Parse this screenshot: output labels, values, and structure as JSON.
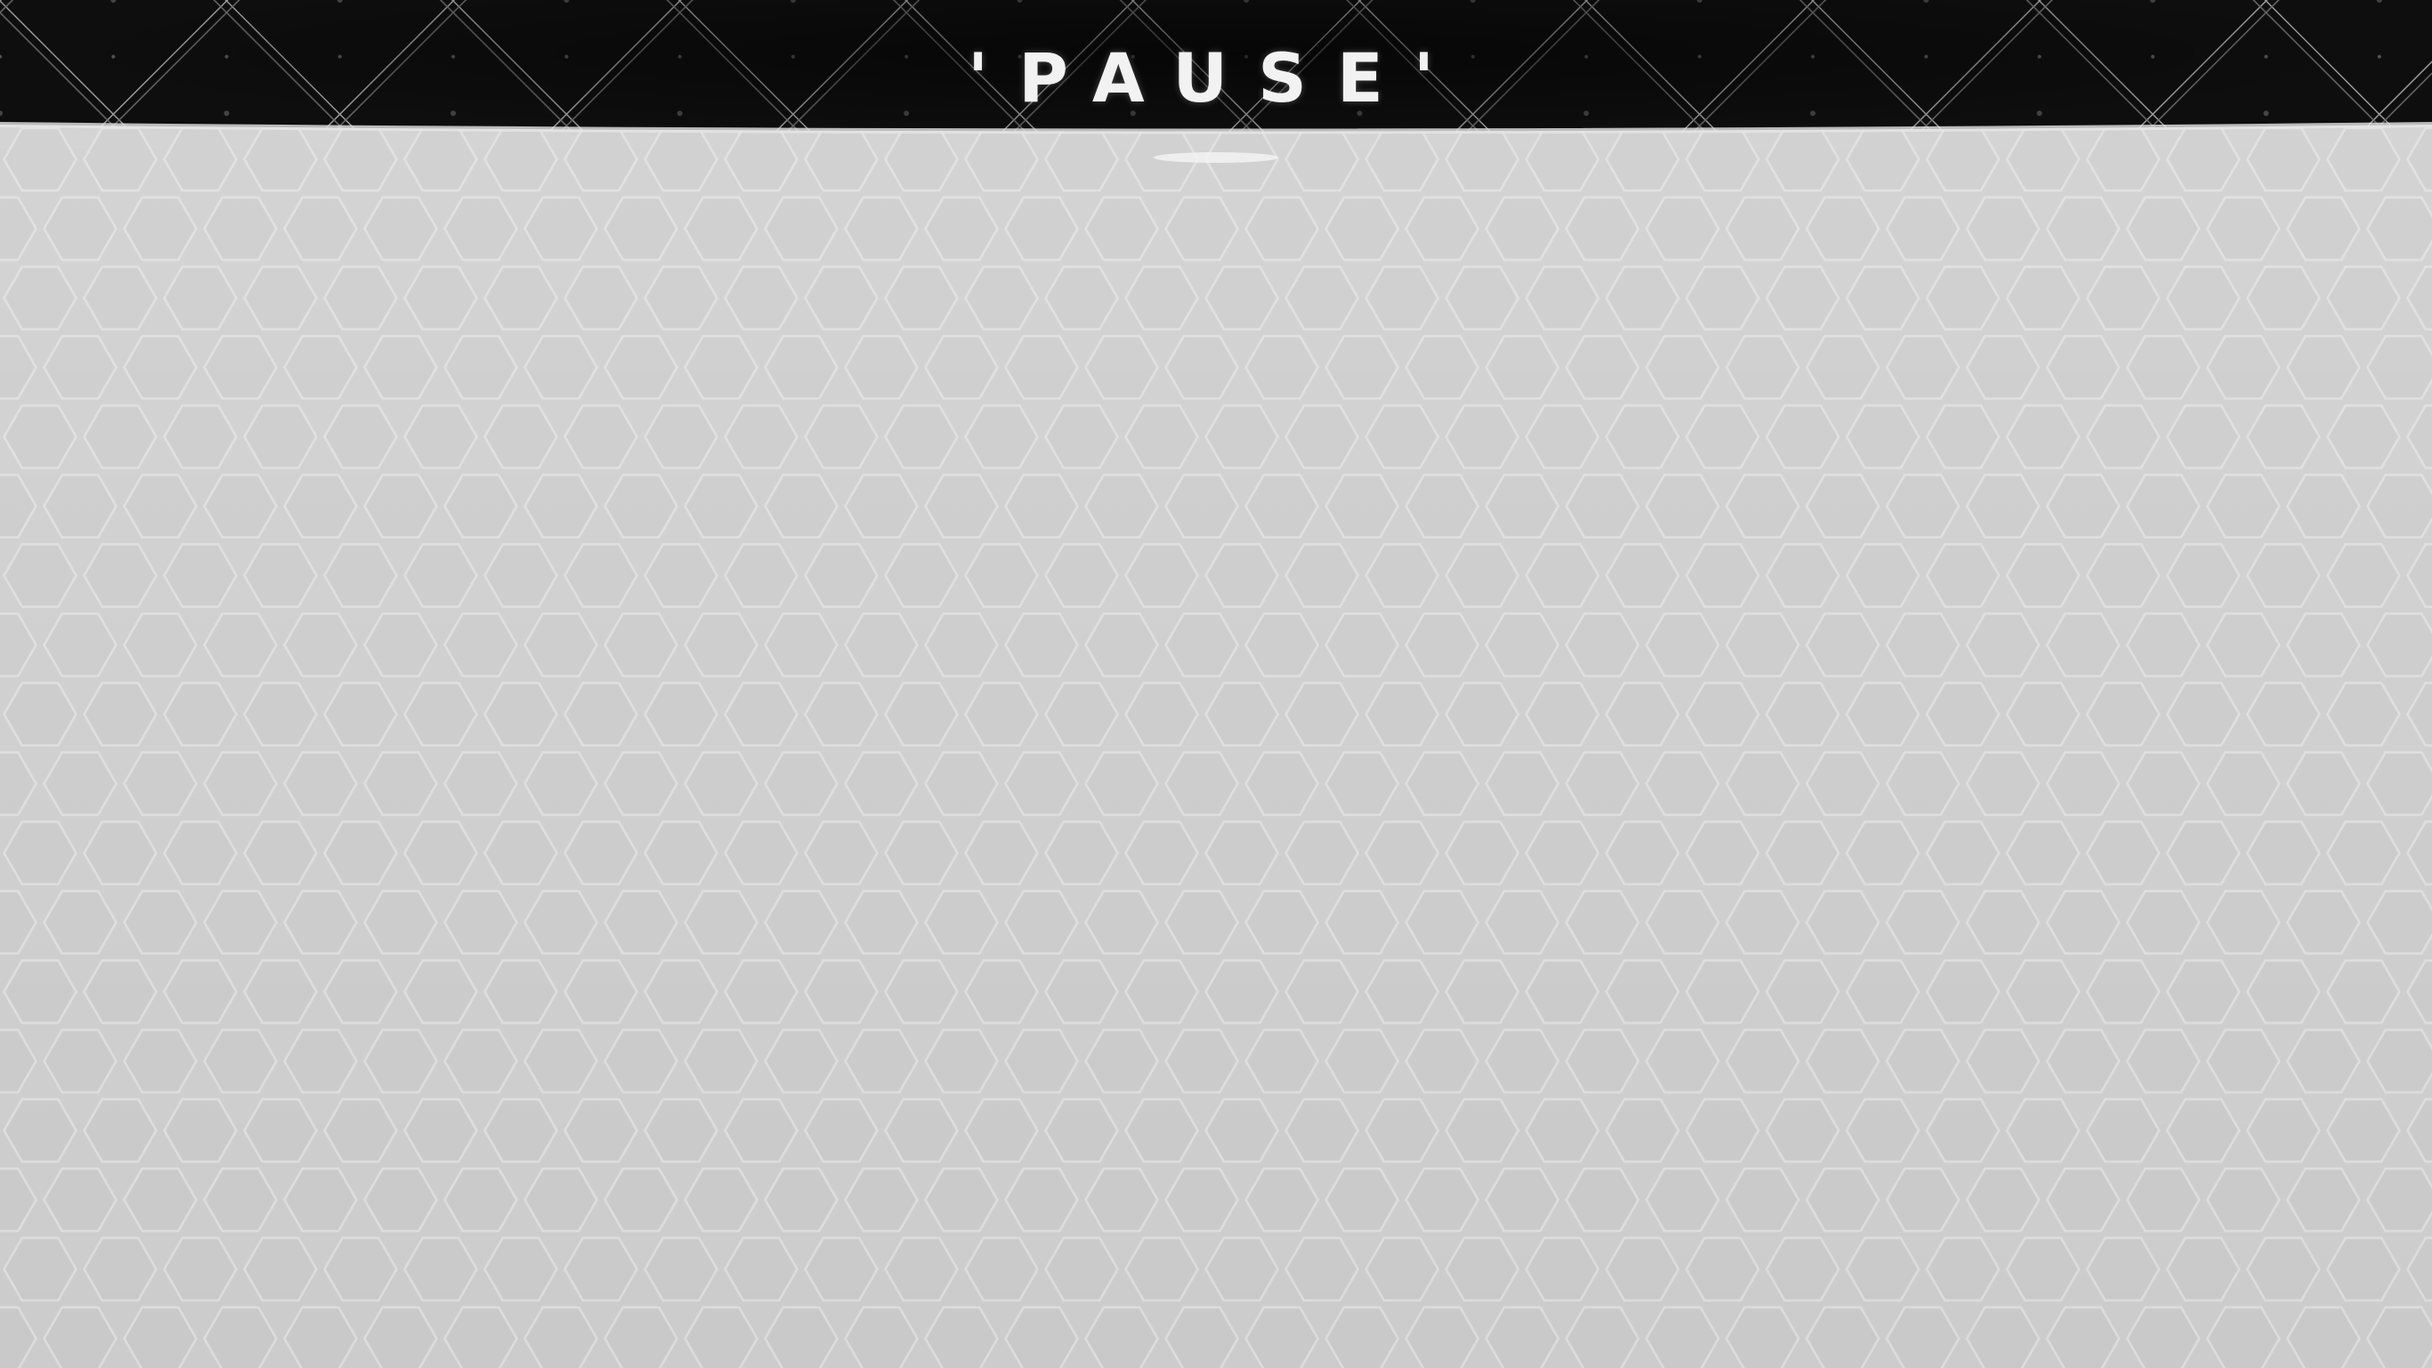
{
  "screen": {
    "title": "'PAUSE'"
  },
  "colors": {
    "banner_bg": "#0e0e0e",
    "lattice_line": "#bfbfbf",
    "panel_fill": "#cfcfcf",
    "hex_line": "#dedede",
    "title_text": "#f2f2f2"
  }
}
